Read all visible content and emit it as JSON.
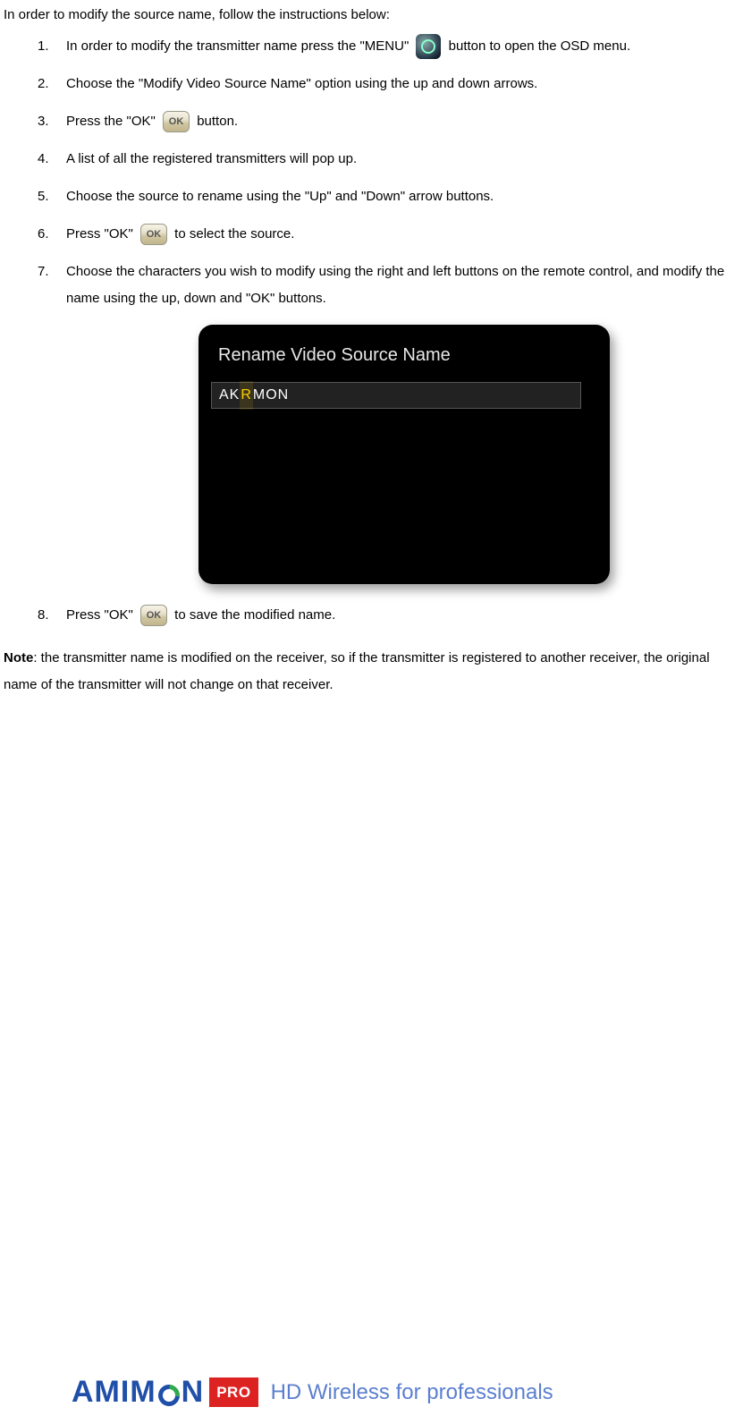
{
  "intro": "In order to modify the source name, follow the instructions below:",
  "steps": [
    {
      "pre": "In order to modify the transmitter name press the \"MENU\" ",
      "icon": "menu",
      "post": " button to open the OSD menu."
    },
    {
      "pre": "Choose the \"Modify Video Source Name\" option using the up and down arrows.",
      "icon": null,
      "post": ""
    },
    {
      "pre": "Press the \"OK\" ",
      "icon": "ok",
      "post": " button."
    },
    {
      "pre": "A list of all the registered transmitters will pop up.",
      "icon": null,
      "post": ""
    },
    {
      "pre": "Choose the source to rename using the \"Up\" and \"Down\" arrow buttons.",
      "icon": null,
      "post": ""
    },
    {
      "pre": "Press \"OK\" ",
      "icon": "ok",
      "post": " to select the source."
    },
    {
      "pre": "Choose the characters you wish to modify using the right and left buttons on the remote control, and modify the name using the up, down and \"OK\" buttons.",
      "icon": null,
      "post": ""
    },
    {
      "pre": "Press \"OK\" ",
      "icon": "ok",
      "post": " to save the modified name."
    }
  ],
  "screenshot": {
    "title": "Rename Video Source Name",
    "value_prefix": "AK",
    "value_highlight": "R",
    "value_suffix": "MON"
  },
  "note_label": "Note",
  "note_text": ": the transmitter name is modified on the receiver, so if the transmitter is registered to another receiver, the original name of the transmitter will not change on that receiver.",
  "footer": {
    "brand_1": "AMIM",
    "brand_2": "N",
    "pro": "PRO",
    "tagline": "HD Wireless for professionals"
  }
}
